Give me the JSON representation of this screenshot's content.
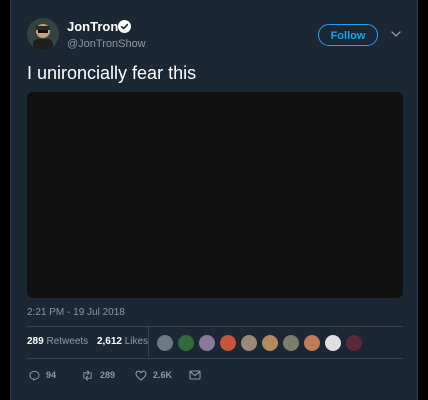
{
  "tweet": {
    "display_name": "JonTron",
    "handle": "@JonTronShow",
    "follow_label": "Follow",
    "text": "I unironcially fear this",
    "timestamp": "2:21 PM - 19 Jul 2018",
    "media_color": "#111111"
  },
  "stats": {
    "retweets_count": "289",
    "retweets_label": "Retweets",
    "likes_count": "2,612",
    "likes_label": "Likes"
  },
  "likers": [
    {
      "name": "liker-1",
      "color": "#6c7a86"
    },
    {
      "name": "liker-2",
      "color": "#2f6b3e"
    },
    {
      "name": "liker-3",
      "color": "#8a7a9a"
    },
    {
      "name": "liker-4",
      "color": "#c2553a"
    },
    {
      "name": "liker-5",
      "color": "#9a8a78"
    },
    {
      "name": "liker-6",
      "color": "#b38a5a"
    },
    {
      "name": "liker-7",
      "color": "#7c7c6a"
    },
    {
      "name": "liker-8",
      "color": "#c47a5a"
    },
    {
      "name": "liker-9",
      "color": "#e0e0e0"
    },
    {
      "name": "liker-10",
      "color": "#5a2a3a"
    }
  ],
  "actions": {
    "reply_count": "94",
    "retweet_count": "289",
    "like_count": "2.6K"
  },
  "icons": {
    "verified": "verified-badge-icon",
    "more": "chevron-down-icon",
    "reply": "reply-icon",
    "retweet": "retweet-icon",
    "like": "heart-icon",
    "dm": "envelope-icon"
  },
  "colors": {
    "background": "#1c2735",
    "accent": "#1da1f2",
    "muted": "#8899a6"
  }
}
